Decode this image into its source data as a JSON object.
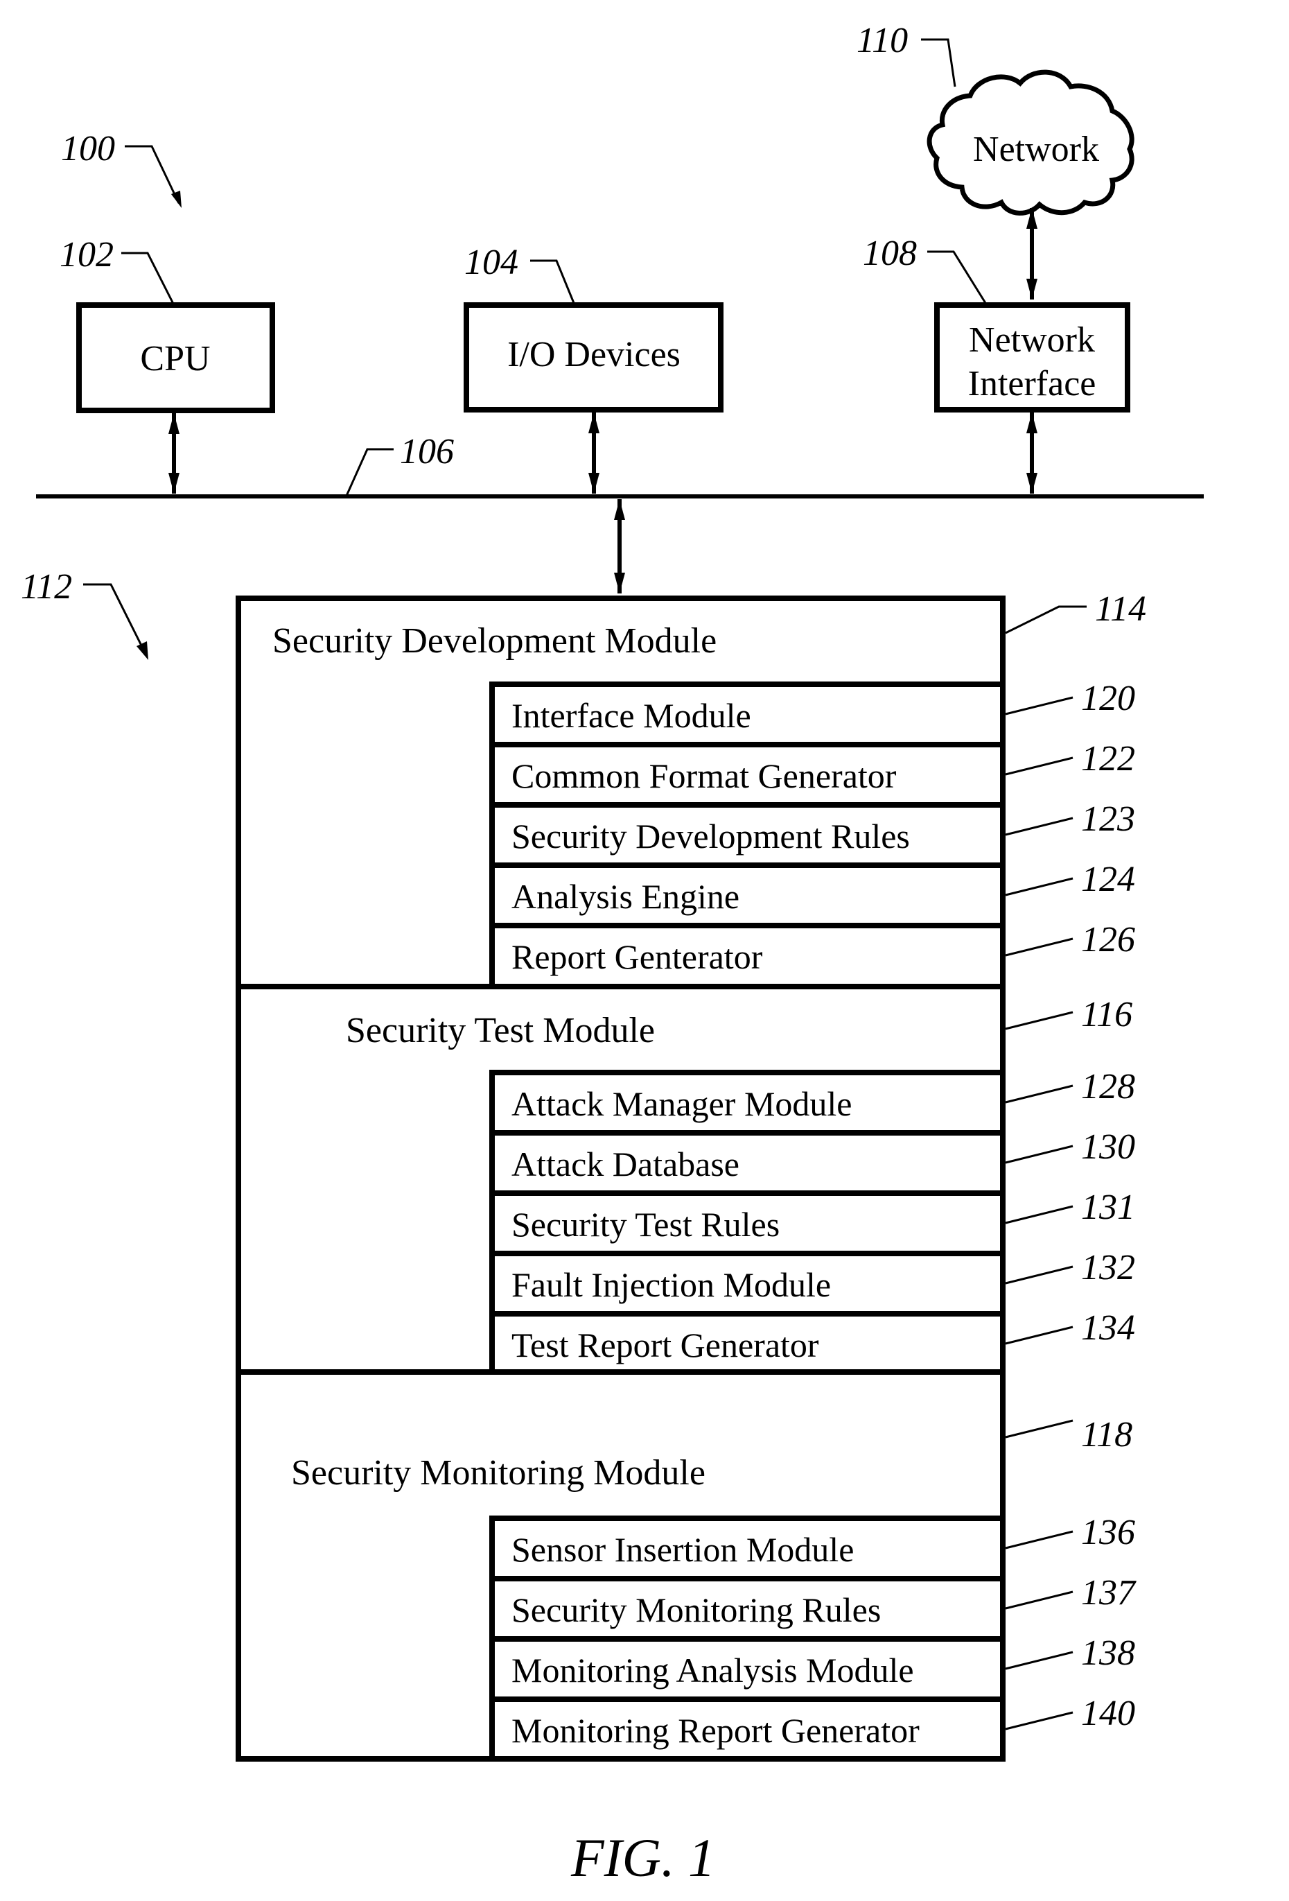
{
  "figure": {
    "caption": "FIG. 1",
    "system_ref": "100",
    "bus": {
      "ref": "106"
    },
    "memory_ref": "112"
  },
  "components": {
    "cpu": {
      "label": "CPU",
      "ref": "102"
    },
    "io": {
      "label": "I/O Devices",
      "ref": "104"
    },
    "network_interface": {
      "label_line1": "Network",
      "label_line2": "Interface",
      "ref": "108"
    },
    "network": {
      "label": "Network",
      "ref": "110"
    }
  },
  "modules": [
    {
      "title": "Security Development Module",
      "ref": "114",
      "items": [
        {
          "label": "Interface Module",
          "ref": "120"
        },
        {
          "label": "Common Format Generator",
          "ref": "122"
        },
        {
          "label": "Security Development Rules",
          "ref": "123"
        },
        {
          "label": "Analysis Engine",
          "ref": "124"
        },
        {
          "label": "Report Genterator",
          "ref": "126"
        }
      ]
    },
    {
      "title": "Security Test Module",
      "ref": "116",
      "items": [
        {
          "label": "Attack Manager Module",
          "ref": "128"
        },
        {
          "label": "Attack Database",
          "ref": "130"
        },
        {
          "label": "Security Test Rules",
          "ref": "131"
        },
        {
          "label": "Fault Injection Module",
          "ref": "132"
        },
        {
          "label": "Test Report Generator",
          "ref": "134"
        }
      ]
    },
    {
      "title": "Security Monitoring Module",
      "ref": "118",
      "items": [
        {
          "label": "Sensor Insertion Module",
          "ref": "136"
        },
        {
          "label": "Security Monitoring Rules",
          "ref": "137"
        },
        {
          "label": "Monitoring Analysis Module",
          "ref": "138"
        },
        {
          "label": "Monitoring Report Generator",
          "ref": "140"
        }
      ]
    }
  ]
}
